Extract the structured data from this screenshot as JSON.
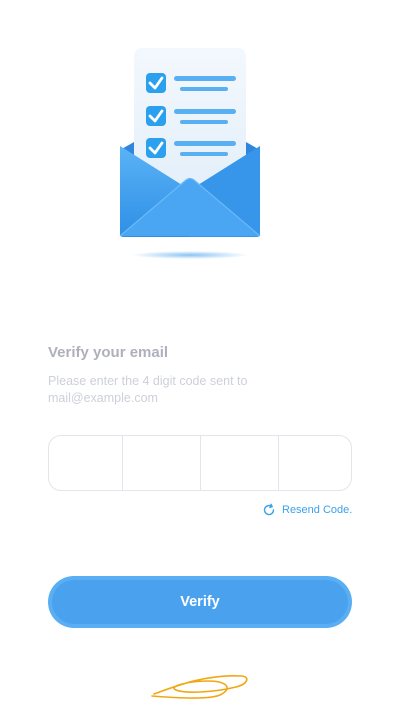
{
  "illustration": {
    "icon": "envelope-checklist-icon",
    "colors": {
      "envelope": "#3a9cf0",
      "envelope_flap": "#2f8fe6",
      "paper": "#e9f2fb",
      "check": "#2aa0ef",
      "lines": "#58b0f2"
    }
  },
  "verify": {
    "title": "Verify your email",
    "subtitle_line1": "Please enter the 4 digit code sent to",
    "subtitle_line2": "mail@example.com"
  },
  "code": {
    "digits": [
      "",
      "",
      "",
      ""
    ]
  },
  "resend": {
    "icon": "refresh-icon",
    "label": "Resend Code."
  },
  "verify_button": {
    "label": "Verify"
  },
  "colors": {
    "accent": "#4aa2ef",
    "accent_light": "#5aaef3",
    "link": "#3aa1ea",
    "title": "#aeb0bb",
    "subtitle": "#cdd0da",
    "border": "#e3e5ea",
    "signature": "#f0a812"
  },
  "decor": {
    "signature": "signature-scribble"
  }
}
